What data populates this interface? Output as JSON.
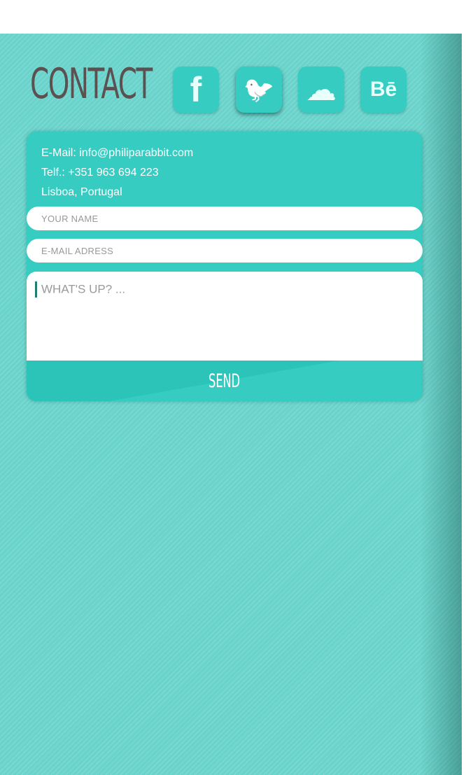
{
  "header": {
    "title": "CONTACT"
  },
  "social": [
    {
      "name": "facebook",
      "glyph": "f"
    },
    {
      "name": "twitter",
      "glyph": "🐦"
    },
    {
      "name": "soundcloud",
      "glyph": "☁"
    },
    {
      "name": "behance",
      "glyph": "Bē"
    }
  ],
  "contact": {
    "email": "E-Mail: info@philiparabbit.com",
    "phone": "Telf.: +351 963 694 223",
    "location": "Lisboa, Portugal"
  },
  "form": {
    "name_placeholder": "YOUR NAME",
    "email_placeholder": "E-MAIL ADRESS",
    "message_placeholder": "WHAT'S UP? ...",
    "send_label": "SEND"
  },
  "colors": {
    "accent": "#36ccc2",
    "background": "#6ad3cb",
    "title": "#5a5150"
  }
}
